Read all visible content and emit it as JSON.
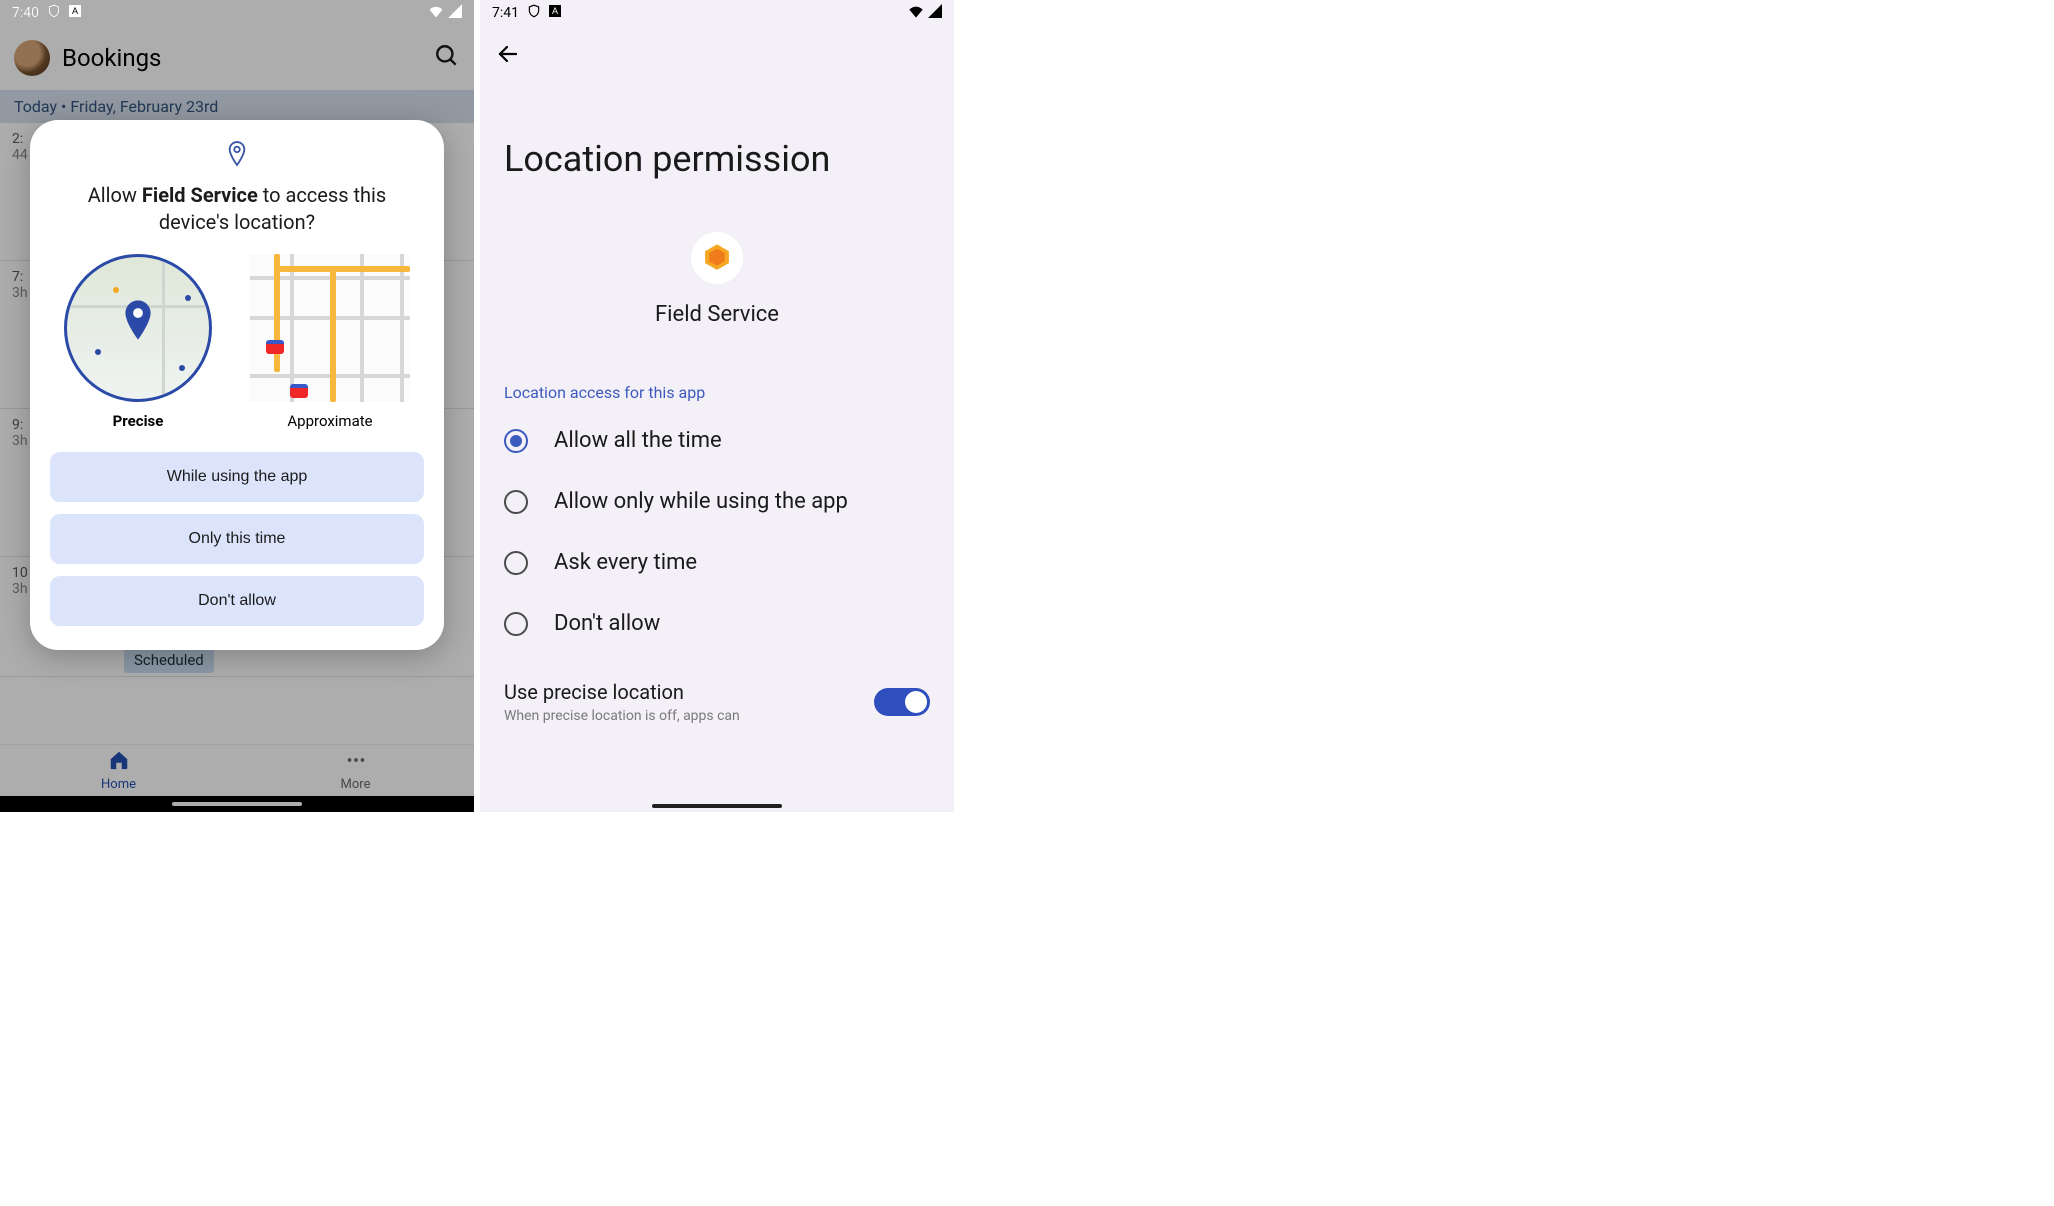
{
  "left": {
    "status_time": "7:40",
    "header_title": "Bookings",
    "date_strip": "Today • Friday, February 23rd",
    "slots": [
      {
        "t1": "2:",
        "t2": "44"
      },
      {
        "t1": "7:",
        "t2": "3h"
      },
      {
        "t1": "9:",
        "t2": "3h"
      },
      {
        "t1": "10",
        "t2": "3h"
      }
    ],
    "scheduled_chip": "Scheduled",
    "nav": {
      "home": "Home",
      "more": "More"
    },
    "dialog": {
      "title_pre": "Allow ",
      "app_name": "Field Service",
      "title_post": " to access this device's location?",
      "precise_label": "Precise",
      "approx_label": "Approximate",
      "btn_while": "While using the app",
      "btn_once": "Only this time",
      "btn_deny": "Don't allow"
    }
  },
  "right": {
    "status_time": "7:41",
    "page_title": "Location permission",
    "app_name": "Field Service",
    "section_label": "Location access for this app",
    "options": [
      {
        "label": "Allow all the time",
        "selected": true
      },
      {
        "label": "Allow only while using the app",
        "selected": false
      },
      {
        "label": "Ask every time",
        "selected": false
      },
      {
        "label": "Don't allow",
        "selected": false
      }
    ],
    "precise": {
      "title": "Use precise location",
      "subtitle": "When precise location is off, apps can"
    }
  }
}
